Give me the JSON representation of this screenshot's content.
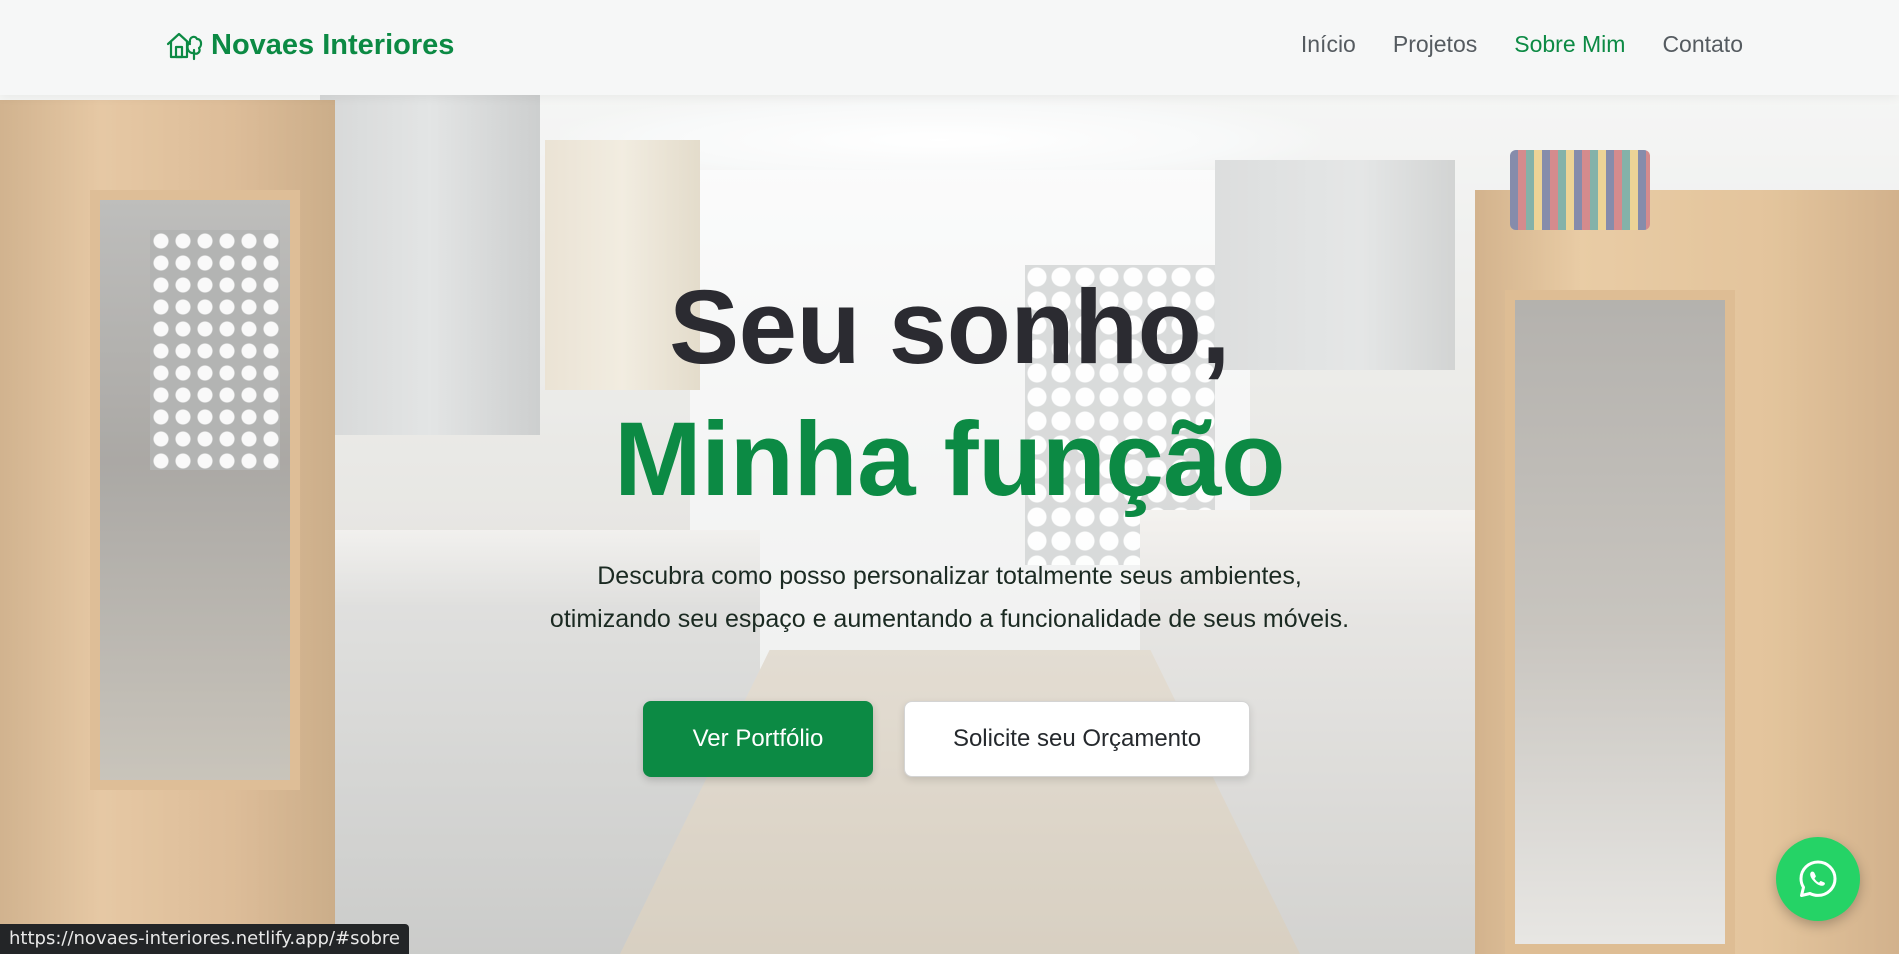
{
  "header": {
    "brand_name": "Novaes Interiores",
    "brand_icon": "house-tree-icon",
    "nav": [
      {
        "label": "Início",
        "active": false
      },
      {
        "label": "Projetos",
        "active": false
      },
      {
        "label": "Sobre Mim",
        "active": true
      },
      {
        "label": "Contato",
        "active": false
      }
    ]
  },
  "hero": {
    "headline_line1": "Seu sonho,",
    "headline_line2": "Minha função",
    "subtitle_line1": "Descubra como posso personalizar totalmente seus ambientes,",
    "subtitle_line2": "otimizando seu espaço e aumentando a funcionalidade de seus móveis.",
    "primary_button": "Ver Portfólio",
    "secondary_button": "Solicite seu Orçamento"
  },
  "floating": {
    "icon": "whatsapp-icon"
  },
  "status_bar": {
    "url": "https://novaes-interiores.netlify.app/#sobre"
  },
  "colors": {
    "brand_green": "#0c8a44",
    "headline_dark": "#2b2b31",
    "nav_text": "#555b60",
    "whatsapp_green": "#25d366"
  }
}
